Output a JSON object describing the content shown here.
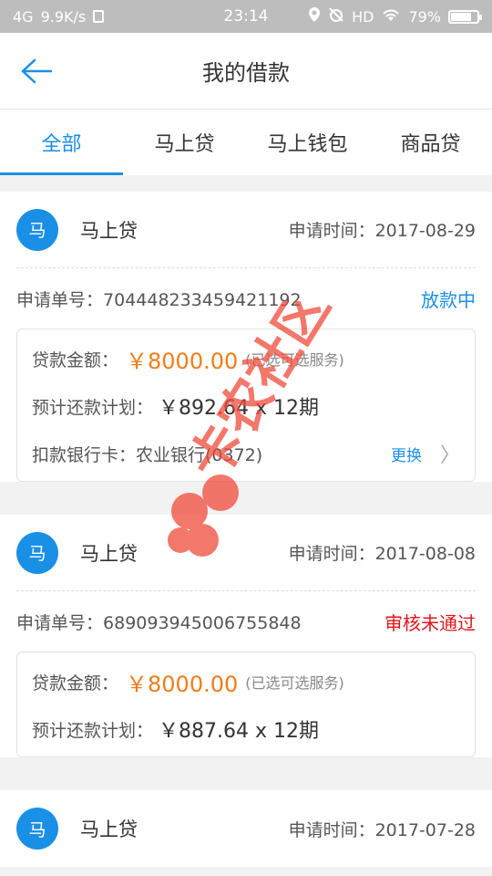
{
  "status_bar": {
    "network": "4G",
    "speed": "9.9K/s",
    "time": "23:14",
    "hd": "HD",
    "battery": "79%",
    "battery_level": 0.79
  },
  "header": {
    "title": "我的借款"
  },
  "tabs": [
    {
      "label": "全部",
      "active": true
    },
    {
      "label": "马上贷",
      "active": false
    },
    {
      "label": "马上钱包",
      "active": false
    },
    {
      "label": "商品贷",
      "active": false
    }
  ],
  "loans": [
    {
      "avatar": "马",
      "product": "马上贷",
      "apply_time": "申请时间：2017-08-29",
      "order_label": "申请单号：",
      "order_no": "704448233459421192",
      "status": "放款中",
      "amount_label": "贷款金额：",
      "amount": "￥8000.00",
      "optional_service": "(已选可选服务)",
      "plan_label": "预计还款计划：",
      "plan": "￥892.64 x 12期",
      "bank_label": "扣款银行卡：农业银行(0372)",
      "change_label": "更换"
    },
    {
      "avatar": "马",
      "product": "马上贷",
      "apply_time": "申请时间：2017-08-08",
      "order_label": "申请单号：",
      "order_no": "689093945006755848",
      "status": "审核未通过",
      "amount_label": "贷款金额：",
      "amount": "￥8000.00",
      "optional_service": "(已选可选服务)",
      "plan_label": "预计还款计划：",
      "plan": "￥887.64 x 12期"
    },
    {
      "avatar": "马",
      "product": "马上贷",
      "apply_time": "申请时间：2017-07-28"
    }
  ],
  "watermark": {
    "text": "卡农社区"
  },
  "colors": {
    "accent": "#1a8fe6",
    "amount": "#f07d1a",
    "status_red": "#e0161a",
    "status_blue": "#1a8fe6"
  }
}
